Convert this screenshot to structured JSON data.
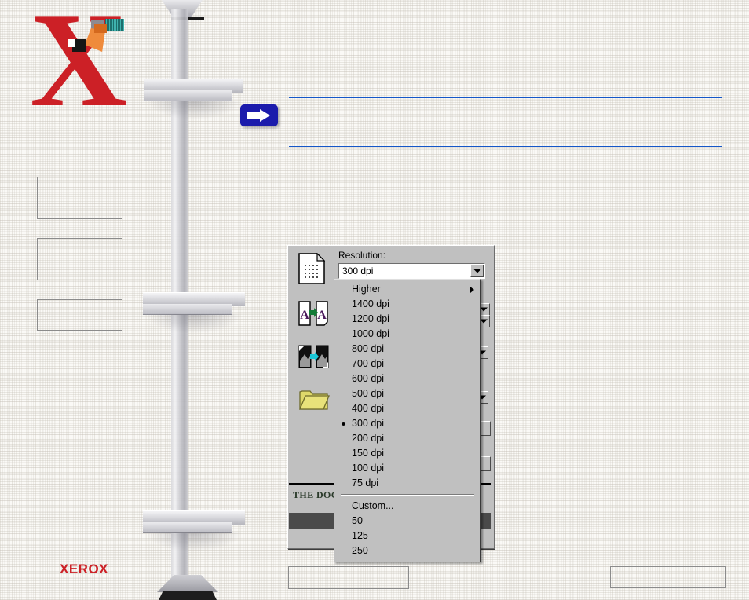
{
  "page": {
    "brand": "XEROX",
    "brand_mark": "X",
    "tagline": "THE DOC"
  },
  "dialog": {
    "title_visible": false,
    "resolution_label": "Resolution:",
    "resolution_value": "300 dpi",
    "dropdown_arrow_icon": "chevron-down-icon",
    "side_icons": [
      {
        "name": "dotted-page-icon",
        "label": "Resolution"
      },
      {
        "name": "a-to-a-icon",
        "label": "Text conversion"
      },
      {
        "name": "image-to-image-icon",
        "label": "Image conversion"
      },
      {
        "name": "folder-icon",
        "label": "Destination folder"
      }
    ]
  },
  "menu": {
    "items": [
      {
        "label": "Higher",
        "has_submenu": true,
        "selected": false
      },
      {
        "label": "1400 dpi",
        "has_submenu": false,
        "selected": false
      },
      {
        "label": "1200 dpi",
        "has_submenu": false,
        "selected": false
      },
      {
        "label": "1000 dpi",
        "has_submenu": false,
        "selected": false
      },
      {
        "label": "800 dpi",
        "has_submenu": false,
        "selected": false
      },
      {
        "label": "700 dpi",
        "has_submenu": false,
        "selected": false
      },
      {
        "label": "600 dpi",
        "has_submenu": false,
        "selected": false
      },
      {
        "label": "500 dpi",
        "has_submenu": false,
        "selected": false
      },
      {
        "label": "400 dpi",
        "has_submenu": false,
        "selected": false
      },
      {
        "label": "300 dpi",
        "has_submenu": false,
        "selected": true
      },
      {
        "label": "200 dpi",
        "has_submenu": false,
        "selected": false
      },
      {
        "label": "150 dpi",
        "has_submenu": false,
        "selected": false
      },
      {
        "label": "100 dpi",
        "has_submenu": false,
        "selected": false
      },
      {
        "label": "75 dpi",
        "has_submenu": false,
        "selected": false
      }
    ],
    "items_after_separator": [
      {
        "label": "Custom...",
        "has_submenu": false,
        "selected": false
      },
      {
        "label": "50",
        "has_submenu": false,
        "selected": false
      },
      {
        "label": "125",
        "has_submenu": false,
        "selected": false
      },
      {
        "label": "250",
        "has_submenu": false,
        "selected": false
      }
    ]
  },
  "colors": {
    "brand_red": "#cc2026",
    "rule_blue": "#1456c8",
    "badge_blue": "#1b1bac",
    "dialog_face": "#c0c0c0",
    "background": "#faf9f6"
  }
}
